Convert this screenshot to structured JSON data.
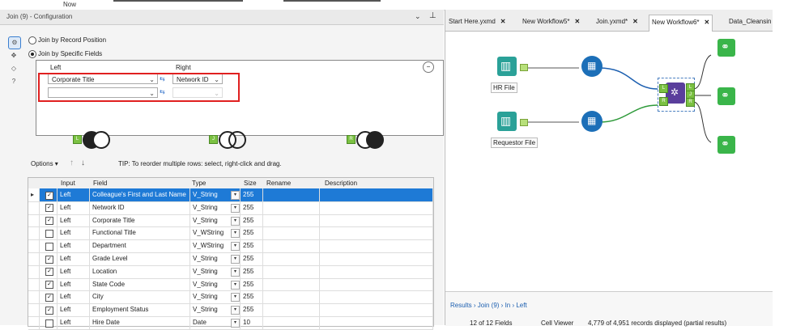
{
  "top": {
    "label": "Now"
  },
  "config": {
    "title": "Join (9) - Configuration",
    "join_by_position": "Join by Record Position",
    "join_by_fields": "Join by Specific Fields",
    "left_header": "Left",
    "right_header": "Right",
    "left_value": "Corporate Title",
    "right_value": "Network ID",
    "venn_left_badge": "L",
    "venn_join_badge": "J",
    "venn_right_badge": "R"
  },
  "options": {
    "label": "Options",
    "tip": "TIP: To reorder multiple rows: select, right-click and drag."
  },
  "grid": {
    "columns": [
      "Input",
      "Field",
      "Type",
      "Size",
      "Rename",
      "Description"
    ],
    "rows": [
      {
        "checked": true,
        "input": "Left",
        "field": "Colleague's First and Last Name",
        "type": "V_String",
        "size": "255"
      },
      {
        "checked": true,
        "input": "Left",
        "field": "Network ID",
        "type": "V_String",
        "size": "255"
      },
      {
        "checked": true,
        "input": "Left",
        "field": "Corporate Title",
        "type": "V_String",
        "size": "255"
      },
      {
        "checked": false,
        "input": "Left",
        "field": "Functional Title",
        "type": "V_WString",
        "size": "255"
      },
      {
        "checked": false,
        "input": "Left",
        "field": "Department",
        "type": "V_WString",
        "size": "255"
      },
      {
        "checked": true,
        "input": "Left",
        "field": "Grade Level",
        "type": "V_String",
        "size": "255"
      },
      {
        "checked": true,
        "input": "Left",
        "field": "Location",
        "type": "V_String",
        "size": "255"
      },
      {
        "checked": true,
        "input": "Left",
        "field": "State Code",
        "type": "V_String",
        "size": "255"
      },
      {
        "checked": true,
        "input": "Left",
        "field": "City",
        "type": "V_String",
        "size": "255"
      },
      {
        "checked": true,
        "input": "Left",
        "field": "Employment Status",
        "type": "V_String",
        "size": "255"
      },
      {
        "checked": false,
        "input": "Left",
        "field": "Hire Date",
        "type": "Date",
        "size": "10"
      }
    ]
  },
  "tabs": [
    {
      "label": "Start Here.yxmd",
      "active": false
    },
    {
      "label": "New Workflow5*",
      "active": false
    },
    {
      "label": "Join.yxmd*",
      "active": false
    },
    {
      "label": "New Workflow6*",
      "active": true
    },
    {
      "label": "Data_Cleansin",
      "active": false
    }
  ],
  "canvas": {
    "hr_file": "HR File",
    "requestor_file": "Requestor File",
    "join_anchors": [
      "L",
      "J",
      "R"
    ]
  },
  "results": {
    "breadcrumb": "Results › Join (9) › In › Left",
    "status": "12 of 12 Fields",
    "viewer": "Cell Viewer",
    "records": "4,779 of 4,951 records displayed (partial results)"
  },
  "colors": {
    "selection": "#1e7ad6",
    "highlight_box": "#e02020",
    "tool_teal": "#2aa198",
    "tool_blue": "#1c6fb8",
    "tool_purple": "#5a3e9c",
    "browse_green": "#3ab54a"
  }
}
